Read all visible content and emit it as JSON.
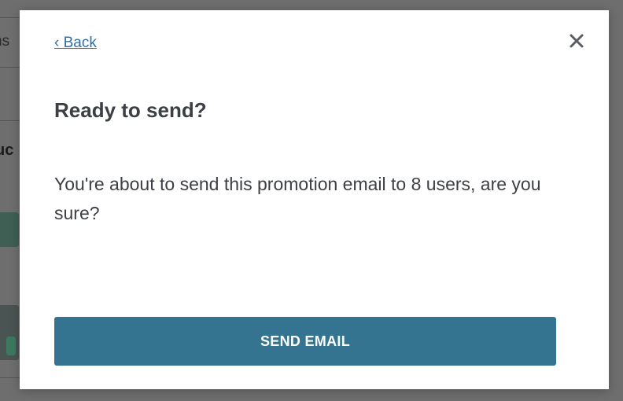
{
  "background_page": {
    "tab_text": "ns",
    "heading_text": "uc"
  },
  "modal": {
    "back_label": "‹ Back",
    "close_icon": "close-icon",
    "title": "Ready to send?",
    "message": "You're about to send this promotion email to 8 users, are you sure?",
    "send_button_label": "SEND EMAIL"
  },
  "colors": {
    "primary_button": "#347491",
    "link": "#2f6fa8",
    "text": "#3c3f44",
    "overlay": "#5f5f5f"
  }
}
